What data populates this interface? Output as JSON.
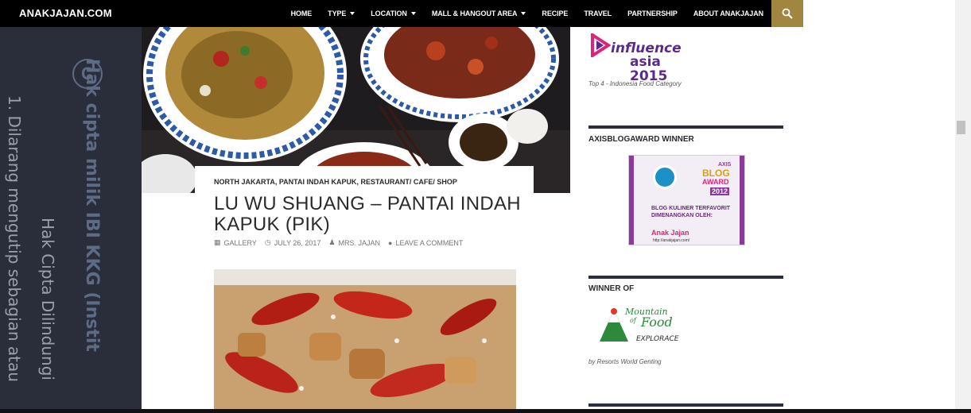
{
  "site": {
    "logo": "ANAKJAJAN.COM"
  },
  "nav": {
    "items": [
      {
        "label": "HOME",
        "dropdown": false
      },
      {
        "label": "TYPE",
        "dropdown": true
      },
      {
        "label": "LOCATION",
        "dropdown": true
      },
      {
        "label": "MALL & HANGOUT AREA",
        "dropdown": true
      },
      {
        "label": "RECIPE",
        "dropdown": false
      },
      {
        "label": "TRAVEL",
        "dropdown": false
      },
      {
        "label": "PARTNERSHIP",
        "dropdown": false
      },
      {
        "label": "ABOUT ANAKJAJAN",
        "dropdown": false
      }
    ],
    "search_icon": "search-icon"
  },
  "watermark": {
    "line1": "1. Dilarang mengutip sebagian atau",
    "line2": "Hak cipta milik IBI KKG (Instit",
    "line3": "Hak Cipta Dilindungi",
    "copyright_symbol": "C"
  },
  "post": {
    "categories": "NORTH JAKARTA, PANTAI INDAH KAPUK, RESTAURANT/ CAFE/ SHOP",
    "title": "LU WU SHUANG – PANTAI INDAH KAPUK (PIK)",
    "meta": {
      "format": "GALLERY",
      "date": "JULY 26, 2017",
      "author": "MRS. JAJAN",
      "comments": "LEAVE A COMMENT"
    }
  },
  "sidebar": {
    "influence": {
      "line1": "influence",
      "line2": "asia 2015",
      "caption": "Top 4 - Indonesia Food Category"
    },
    "axis": {
      "title": "AXISBLOGAWARD WINNER",
      "badge_brand": "AXIS",
      "badge_blog": "BLOG",
      "badge_award": "AWARD",
      "badge_year": "2012",
      "badge_text": "BLOG KULINER TERFAVORIT DIMENANGKAN OLEH:",
      "badge_name": "Anak Jajan",
      "badge_url": "http://anakjajan.com/"
    },
    "winner": {
      "title": "WINNER OF",
      "line1": "Mountain",
      "line2": "of",
      "line3": "Food",
      "line4": "EXPLORACE",
      "caption": "by Resorts World Genting"
    }
  },
  "colors": {
    "nav_bg": "#000000",
    "search_bg": "#a08640",
    "panel_bg": "#2a2d3a",
    "influence_purple": "#5a2a8c",
    "influence_pink": "#e0237a",
    "axis_purple": "#8a3a9a",
    "mountain_green": "#2c8a3a"
  }
}
